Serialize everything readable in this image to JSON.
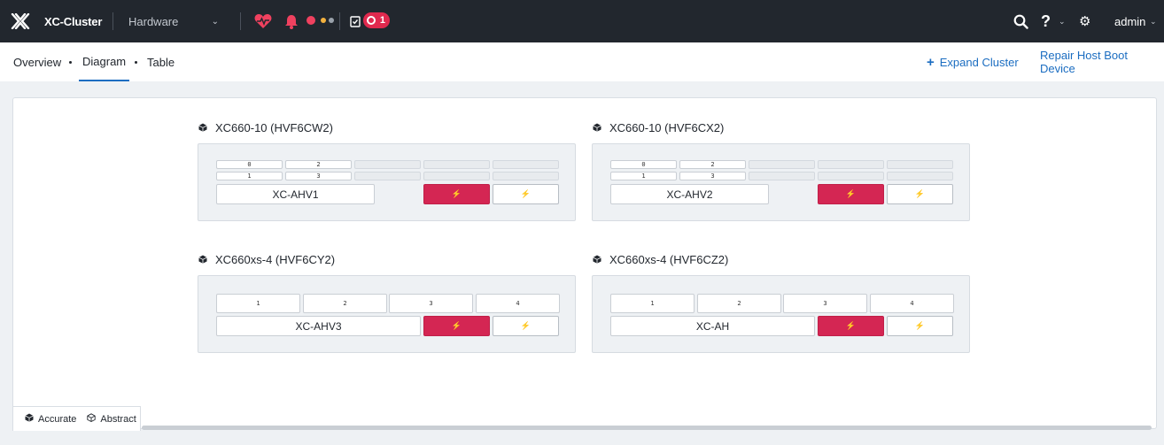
{
  "header": {
    "app_name": "XC-Cluster",
    "entity_selector": "Hardware",
    "task_count": "1",
    "user": "admin"
  },
  "colors": {
    "accent": "#1b6dc1",
    "critical": "#e0294e",
    "warning": "#f3b13e",
    "topbar": "#22272e"
  },
  "icons": [
    "x-logo-icon",
    "heart-pulse-icon",
    "bell-icon",
    "clipboard-check-icon",
    "search-icon",
    "help-icon",
    "gear-icon",
    "cube-icon"
  ],
  "tabs": [
    {
      "label": "Overview",
      "active": false
    },
    {
      "label": "Diagram",
      "active": true
    },
    {
      "label": "Table",
      "active": false
    }
  ],
  "actions": {
    "expand_cluster": "Expand Cluster",
    "repair_host_boot": "Repair Host Boot Device"
  },
  "blocks": [
    {
      "title": "XC660-10 (HVF6CW2)",
      "host": "XC-AHV1",
      "slots": [
        "0",
        "2",
        "1",
        "3"
      ]
    },
    {
      "title": "XC660-10 (HVF6CX2)",
      "host": "XC-AHV2",
      "slots": [
        "0",
        "2",
        "1",
        "3"
      ]
    },
    {
      "title": "XC660xs-4 (HVF6CY2)",
      "host": "XC-AHV3",
      "slots": [
        "1",
        "2",
        "3",
        "4"
      ]
    },
    {
      "title": "XC660xs-4 (HVF6CZ2)",
      "host": "XC-AH",
      "slots": [
        "1",
        "2",
        "3",
        "4"
      ]
    }
  ],
  "legend": {
    "accurate": "Accurate",
    "abstract": "Abstract"
  }
}
